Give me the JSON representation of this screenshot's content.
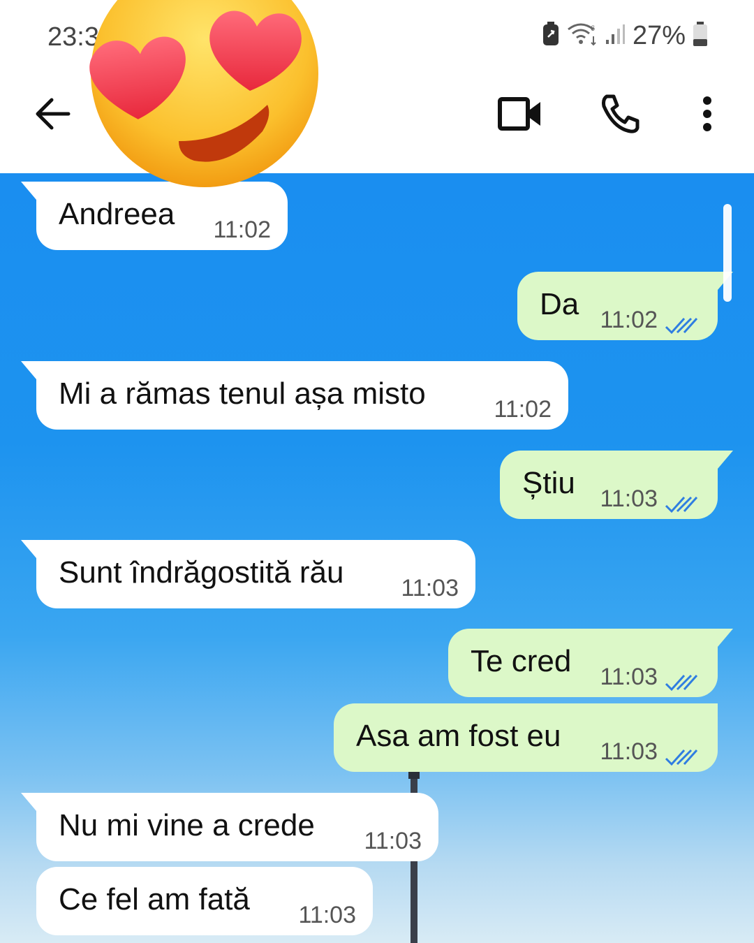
{
  "status_bar": {
    "time": "23:3",
    "battery_percent": "27%",
    "icons": [
      "battery-saver-icon",
      "wifi-icon",
      "signal-icon",
      "battery-icon"
    ]
  },
  "header": {
    "back_icon": "arrow-left-icon",
    "actions": [
      "video-call-icon",
      "phone-icon",
      "more-vert-icon"
    ]
  },
  "sticker": {
    "icon": "heart-eyes-emoji-icon"
  },
  "messages": [
    {
      "direction": "incoming",
      "text": "Andreea",
      "time": "11:02"
    },
    {
      "direction": "outgoing",
      "text": "Da",
      "time": "11:02",
      "status": "read"
    },
    {
      "direction": "incoming",
      "text": "Mi a rămas tenul așa misto",
      "time": "11:02"
    },
    {
      "direction": "outgoing",
      "text": "Știu",
      "time": "11:03",
      "status": "read"
    },
    {
      "direction": "incoming",
      "text": "Sunt îndrăgostită rău",
      "time": "11:03"
    },
    {
      "direction": "outgoing",
      "text": "Te cred",
      "time": "11:03",
      "status": "read"
    },
    {
      "direction": "outgoing",
      "text": "Asa am fost eu",
      "time": "11:03",
      "status": "read"
    },
    {
      "direction": "incoming",
      "text": "Nu mi vine a crede",
      "time": "11:03"
    },
    {
      "direction": "incoming",
      "text": "Ce fel am fată",
      "time": "11:03"
    }
  ],
  "colors": {
    "incoming_bubble": "#ffffff",
    "outgoing_bubble": "#dcf8c8",
    "read_ticks": "#2f7de1",
    "chat_background_top": "#1a8ef0",
    "chat_background_bottom": "#d8ebf5"
  }
}
